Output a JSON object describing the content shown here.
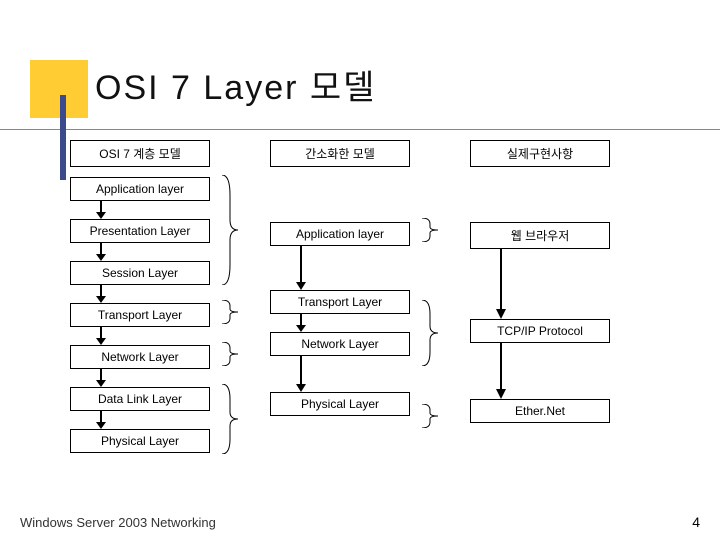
{
  "title": "OSI 7 Layer 모델",
  "columns": {
    "osi": {
      "header": "OSI 7 계층 모델",
      "layers": [
        "Application layer",
        "Presentation Layer",
        "Session Layer",
        "Transport Layer",
        "Network Layer",
        "Data Link Layer",
        "Physical Layer"
      ]
    },
    "simplified": {
      "header": "간소화한 모델",
      "layers": [
        "Application layer",
        "Transport Layer",
        "Network Layer",
        "Physical Layer"
      ]
    },
    "implementation": {
      "header": "실제구현사항",
      "items": [
        "웹 브라우저",
        "TCP/IP Protocol",
        "Ether.Net"
      ]
    }
  },
  "footer": "Windows  Server 2003 Networking",
  "page": "4"
}
